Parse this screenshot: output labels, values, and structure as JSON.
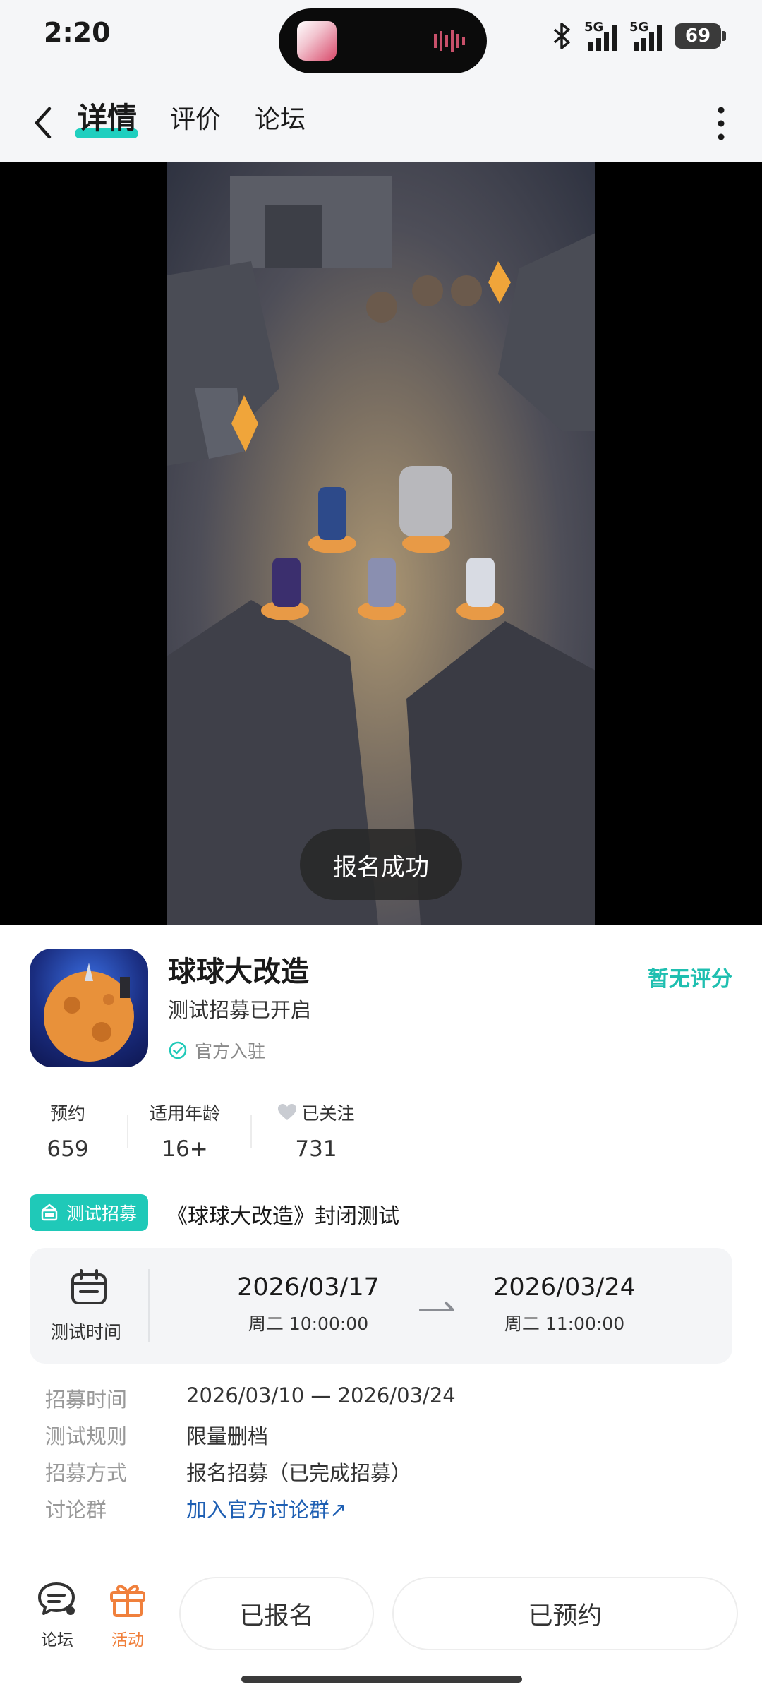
{
  "status": {
    "time": "2:20",
    "signal1": "5G",
    "signal2": "5G",
    "battery": "69"
  },
  "nav": {
    "tabs": [
      {
        "label": "详情"
      },
      {
        "label": "评价"
      },
      {
        "label": "论坛"
      }
    ]
  },
  "video": {
    "toast": "报名成功"
  },
  "app": {
    "name": "球球大改造",
    "subtitle": "测试招募已开启",
    "verified_label": "官方入驻",
    "rating": "暂无评分"
  },
  "stats": [
    {
      "label": "预约",
      "value": "659"
    },
    {
      "label": "适用年龄",
      "value": "16+"
    },
    {
      "label": "已关注",
      "value": "731"
    }
  ],
  "test": {
    "badge": "测试招募",
    "title": "《球球大改造》封闭测试",
    "time_label": "测试时间",
    "start_date": "2026/03/17",
    "start_sub": "周二  10:00:00",
    "end_date": "2026/03/24",
    "end_sub": "周二  11:00:00"
  },
  "info": [
    {
      "key": "招募时间",
      "value": "2026/03/10 — 2026/03/24"
    },
    {
      "key": "测试规则",
      "value": "限量删档"
    },
    {
      "key": "招募方式",
      "value": "报名招募（已完成招募）"
    },
    {
      "key": "讨论群",
      "value": "加入官方讨论群↗"
    }
  ],
  "bottom": {
    "forum": "论坛",
    "activity": "活动",
    "signed": "已报名",
    "reserved": "已预约"
  },
  "colors": {
    "accent": "#1fc9b8",
    "activity": "#f0803c",
    "link": "#1e5fb3"
  },
  "icons": [
    "back-icon",
    "more-icon",
    "verified-check-icon",
    "heart-icon",
    "test-icon",
    "calendar-icon",
    "arrow-right-icon",
    "forum-icon",
    "gift-icon"
  ]
}
